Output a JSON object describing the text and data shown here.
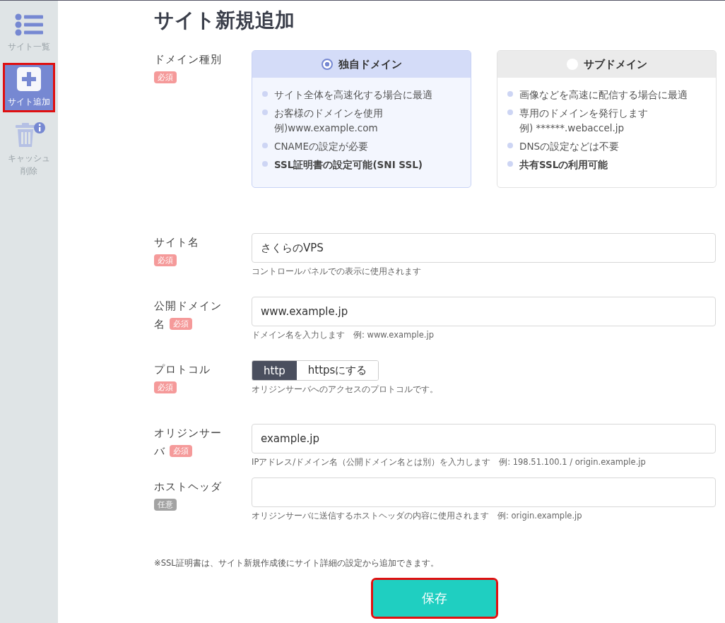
{
  "sidebar": {
    "items": [
      {
        "label": "サイト一覧",
        "selected": false,
        "disabled": false,
        "highlighted": false
      },
      {
        "label": "サイト追加",
        "selected": true,
        "disabled": false,
        "highlighted": true
      },
      {
        "label": "キャッシュ削除",
        "selected": false,
        "disabled": true,
        "highlighted": false
      }
    ]
  },
  "title": "サイト新規追加",
  "domain_type": {
    "label": "ドメイン種別",
    "badge": {
      "kind": "required",
      "text": "必須"
    },
    "options": [
      {
        "title": "独自ドメイン",
        "selected": true,
        "features": [
          {
            "text": "サイト全体を高速化する場合に最適",
            "bold": false
          },
          {
            "text": "お客様のドメインを使用",
            "sub": "例)www.example.com",
            "bold": false
          },
          {
            "text": "CNAMEの設定が必要",
            "bold": false
          },
          {
            "text": "SSL証明書の設定可能(SNI SSL)",
            "bold": true
          }
        ]
      },
      {
        "title": "サブドメイン",
        "selected": false,
        "features": [
          {
            "text": "画像などを高速に配信する場合に最適",
            "bold": false
          },
          {
            "text": "専用のドメインを発行します",
            "sub": "例) ******.webaccel.jp",
            "bold": false
          },
          {
            "text": "DNSの設定などは不要",
            "bold": false
          },
          {
            "text": "共有SSLの利用可能",
            "bold": true
          }
        ]
      }
    ]
  },
  "fields": [
    {
      "kind": "text",
      "label": [
        "サイト名"
      ],
      "badge": {
        "kind": "required",
        "text": "必須"
      },
      "value": "さくらのVPS",
      "hint": "コントロールパネルでの表示に使用されます"
    },
    {
      "kind": "text",
      "label": [
        "公開ドメイン",
        "名"
      ],
      "badge": {
        "kind": "required",
        "text": "必須"
      },
      "value": "www.example.jp",
      "hint": "ドメイン名を入力します　例: www.example.jp"
    },
    {
      "kind": "toggle",
      "label": [
        "プロトコル"
      ],
      "badge": {
        "kind": "required",
        "text": "必須"
      },
      "options": [
        {
          "label": "http",
          "selected": true
        },
        {
          "label": "httpsにする",
          "selected": false
        }
      ],
      "hint": "オリジンサーバへのアクセスのプロトコルです。"
    },
    {
      "kind": "text",
      "label": [
        "オリジンサー",
        "バ"
      ],
      "badge": {
        "kind": "required",
        "text": "必須"
      },
      "value": "example.jp",
      "hint": "IPアドレス/ドメイン名（公開ドメイン名とは別）を入力します　例: 198.51.100.1 / origin.example.jp"
    },
    {
      "kind": "text",
      "label": [
        "ホストヘッダ"
      ],
      "badge": {
        "kind": "optional",
        "text": "任意"
      },
      "hint": "オリジンサーバに送信するホストヘッダの内容に使用されます　例: origin.example.jp"
    }
  ],
  "note": "※SSL証明書は、サイト新規作成後にサイト詳細の設定から追加できます。",
  "save_button": {
    "label": "保存",
    "highlighted": true
  }
}
